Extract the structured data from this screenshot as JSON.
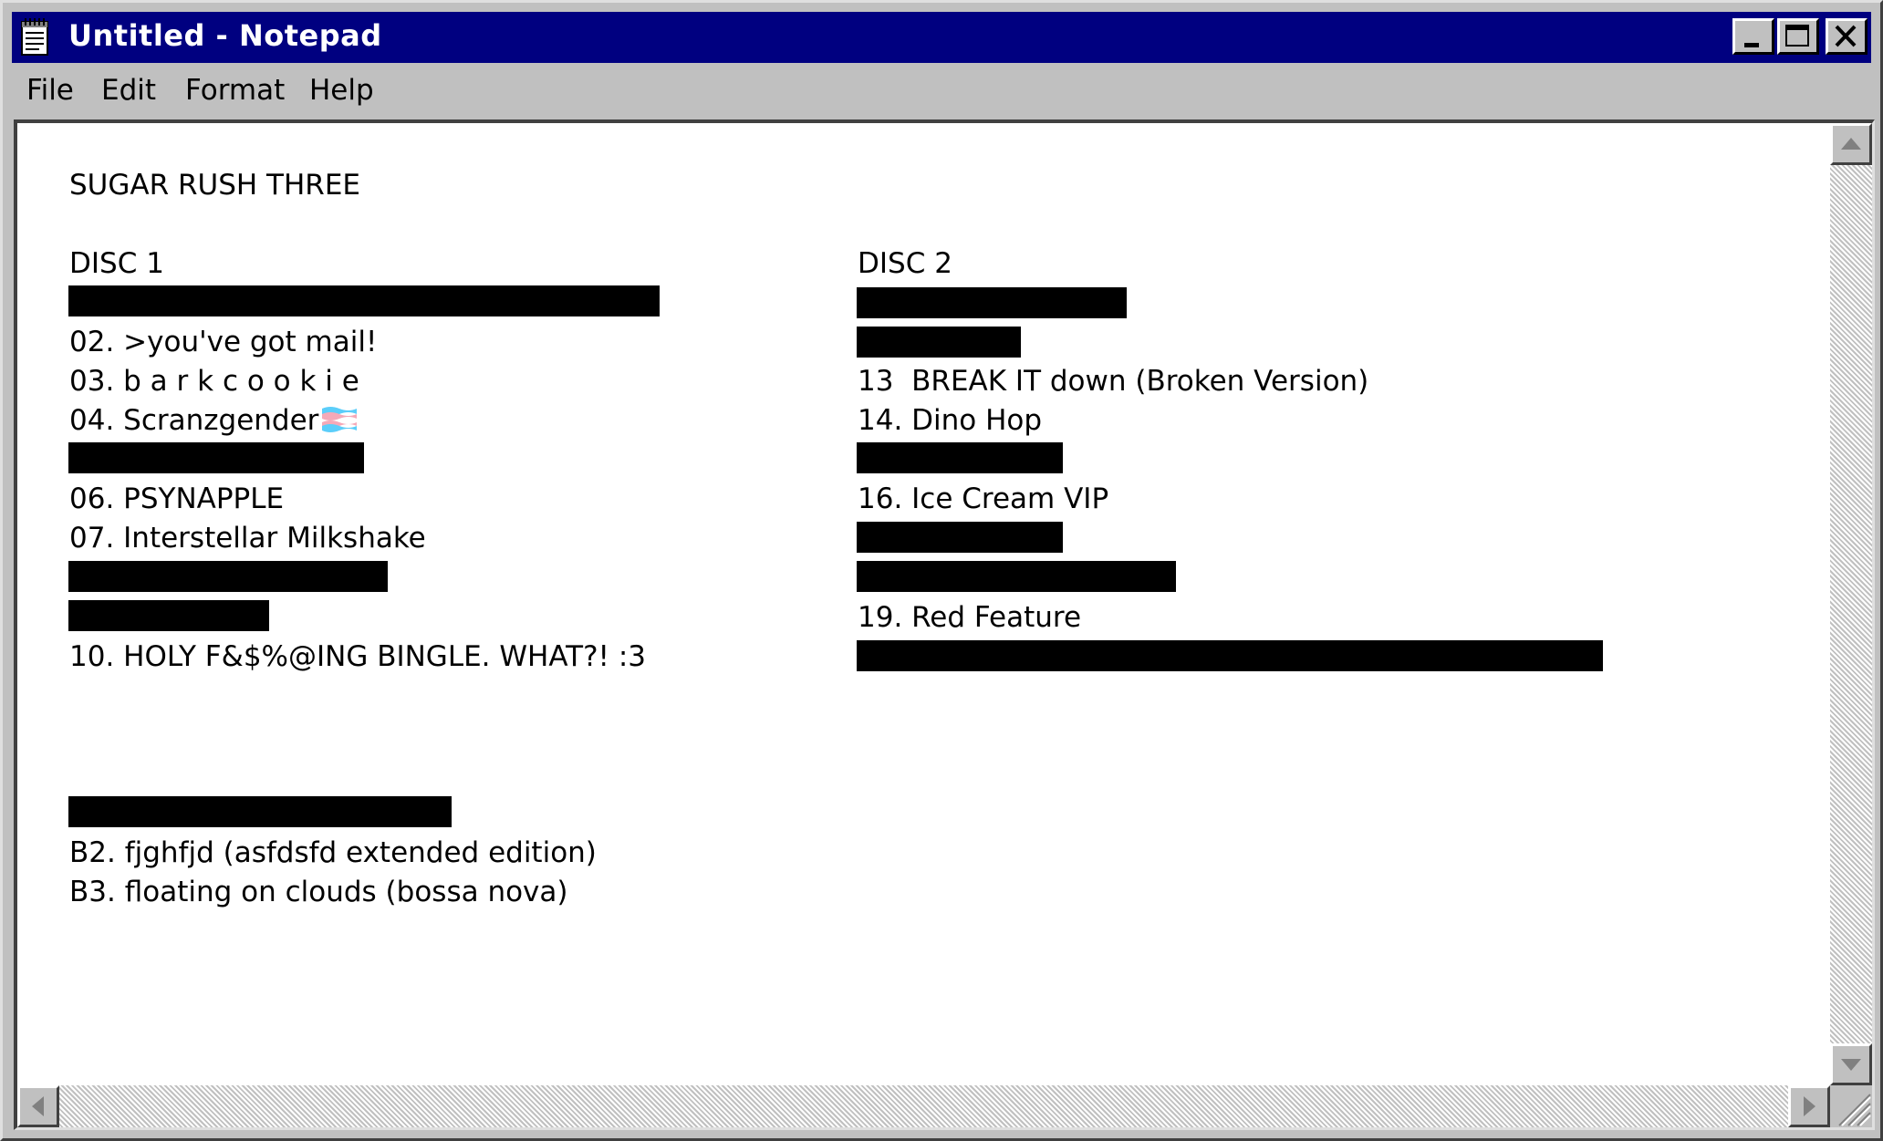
{
  "window": {
    "title": "Untitled - Notepad",
    "icons": {
      "app": "notepad-icon",
      "minimize": "minimize-icon",
      "maximize": "maximize-icon",
      "close": "close-icon"
    },
    "colors": {
      "titlebar": "#000080",
      "chrome": "#c0c0c0",
      "editor_background": "#ffffff",
      "redaction": "#000000"
    }
  },
  "menu": {
    "items": [
      "File",
      "Edit",
      "Format",
      "Help"
    ]
  },
  "document": {
    "title": "SUGAR RUSH THREE",
    "disc1": {
      "header": "DISC 1",
      "tracks": [
        "02. >you've got mail!",
        "03. b a r k c o o k i e",
        "04. Scranzgender",
        "06. PSYNAPPLE",
        "07. Interstellar Milkshake",
        "10. HOLY F&$%@ING BINGLE. WHAT?! :3"
      ],
      "bonus_tracks": [
        "B2. fjghfjd (asfdsfd extended edition)",
        "B3. floating on clouds (bossa nova)"
      ],
      "emoji": "transgender-flag-icon"
    },
    "disc2": {
      "header": "DISC 2",
      "tracks": [
        "13  BREAK IT down (Broken Version)",
        "14. Dino Hop",
        "16. Ice Cream VIP",
        "19. Red Feature"
      ]
    }
  },
  "scrollbars": {
    "icons": [
      "scroll-up-icon",
      "scroll-down-icon",
      "scroll-left-icon",
      "scroll-right-icon",
      "resize-grip-icon"
    ]
  }
}
